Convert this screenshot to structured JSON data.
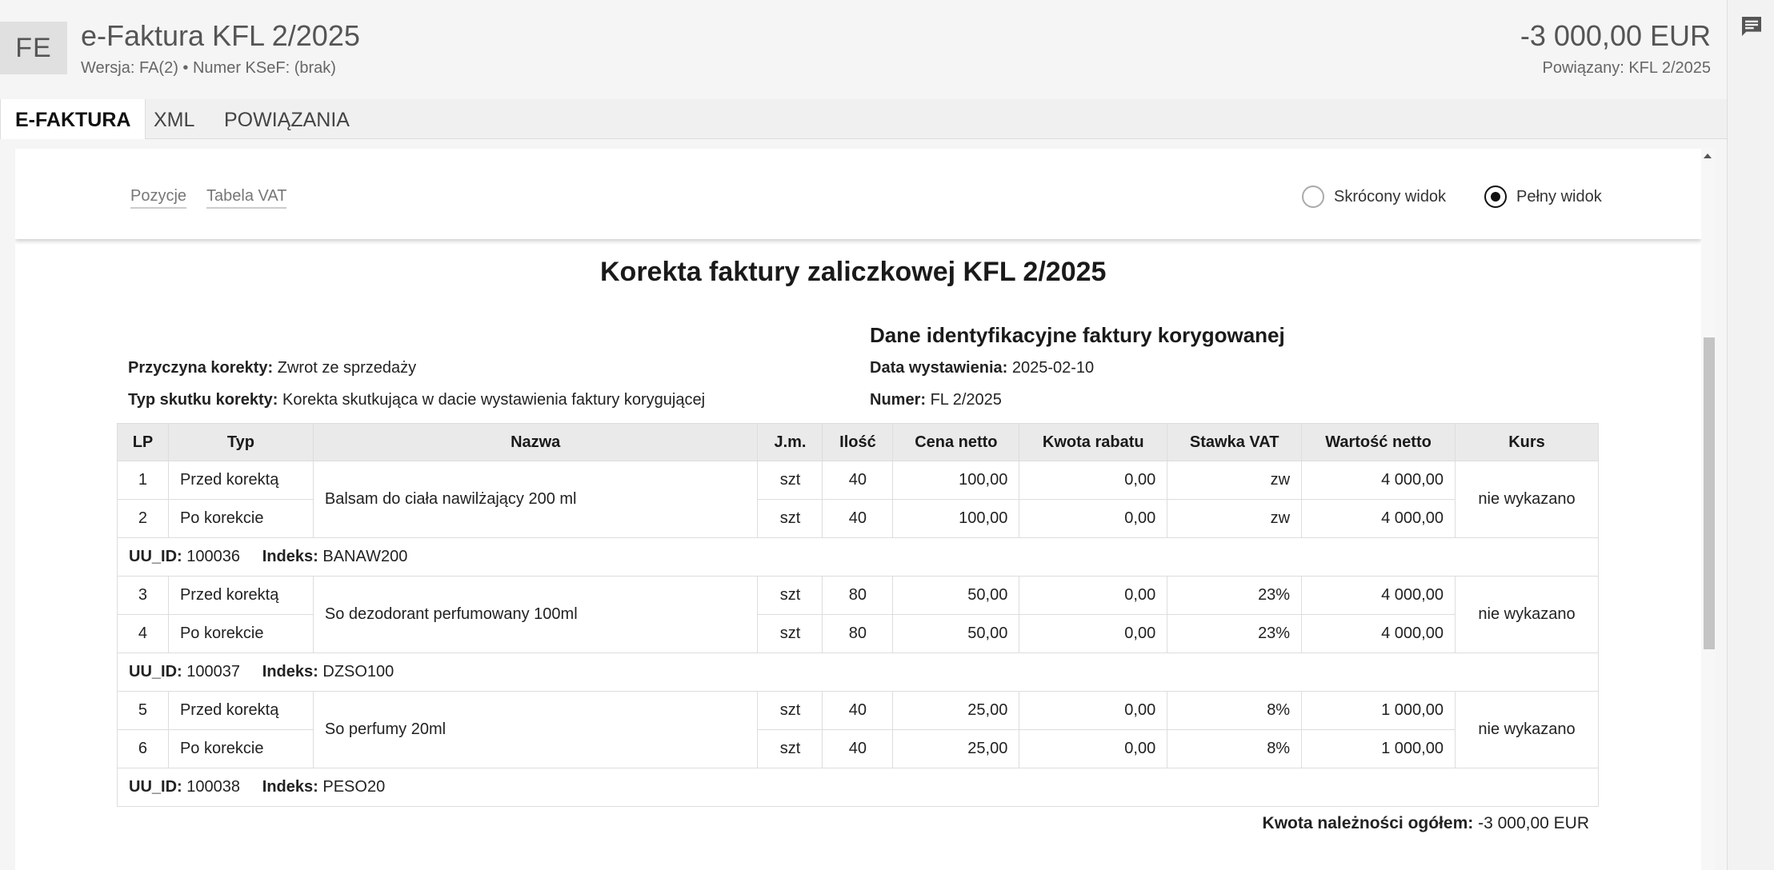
{
  "header": {
    "avatar": "FE",
    "title": "e-Faktura KFL 2/2025",
    "subtitle": "Wersja: FA(2) • Numer KSeF: (brak)",
    "amount": "-3 000,00 EUR",
    "linked": "Powiązany: KFL 2/2025"
  },
  "tabs": [
    {
      "label": "E-FAKTURA",
      "active": true
    },
    {
      "label": "XML",
      "active": false
    },
    {
      "label": "POWIĄZANIA",
      "active": false
    }
  ],
  "toolbar": {
    "link_positions": "Pozycje",
    "link_vat": "Tabela VAT",
    "radio_short": "Skrócony widok",
    "radio_full": "Pełny widok",
    "selected": "Pełny widok"
  },
  "invoice": {
    "title": "Korekta faktury zaliczkowej KFL 2/2025",
    "reason_label": "Przyczyna korekty:",
    "reason_value": "Zwrot ze sprzedaży",
    "effect_label": "Typ skutku korekty:",
    "effect_value": "Korekta skutkująca w dacie wystawienia faktury korygującej",
    "corrected_heading": "Dane identyfikacyjne faktury korygowanej",
    "issue_date_label": "Data wystawienia:",
    "issue_date_value": "2025-02-10",
    "number_label": "Numer:",
    "number_value": "FL 2/2025",
    "columns": [
      "LP",
      "Typ",
      "Nazwa",
      "J.m.",
      "Ilość",
      "Cena netto",
      "Kwota rabatu",
      "Stawka VAT",
      "Wartość netto",
      "Kurs"
    ],
    "groups": [
      {
        "name": "Balsam do ciała nawilżający 200 ml",
        "kurs": "nie wykazano",
        "rows": [
          {
            "lp": "1",
            "typ": "Przed korektą",
            "jm": "szt",
            "ilosc": "40",
            "cena": "100,00",
            "rabat": "0,00",
            "vat": "zw",
            "wartosc": "4 000,00"
          },
          {
            "lp": "2",
            "typ": "Po korekcie",
            "jm": "szt",
            "ilosc": "40",
            "cena": "100,00",
            "rabat": "0,00",
            "vat": "zw",
            "wartosc": "4 000,00"
          }
        ],
        "uu_label": "UU_ID:",
        "uu_value": "100036",
        "idx_label": "Indeks:",
        "idx_value": "BANAW200"
      },
      {
        "name": "So dezodorant perfumowany 100ml",
        "kurs": "nie wykazano",
        "rows": [
          {
            "lp": "3",
            "typ": "Przed korektą",
            "jm": "szt",
            "ilosc": "80",
            "cena": "50,00",
            "rabat": "0,00",
            "vat": "23%",
            "wartosc": "4 000,00"
          },
          {
            "lp": "4",
            "typ": "Po korekcie",
            "jm": "szt",
            "ilosc": "80",
            "cena": "50,00",
            "rabat": "0,00",
            "vat": "23%",
            "wartosc": "4 000,00"
          }
        ],
        "uu_label": "UU_ID:",
        "uu_value": "100037",
        "idx_label": "Indeks:",
        "idx_value": "DZSO100"
      },
      {
        "name": "So perfumy 20ml",
        "kurs": "nie wykazano",
        "rows": [
          {
            "lp": "5",
            "typ": "Przed korektą",
            "jm": "szt",
            "ilosc": "40",
            "cena": "25,00",
            "rabat": "0,00",
            "vat": "8%",
            "wartosc": "1 000,00"
          },
          {
            "lp": "6",
            "typ": "Po korekcie",
            "jm": "szt",
            "ilosc": "40",
            "cena": "25,00",
            "rabat": "0,00",
            "vat": "8%",
            "wartosc": "1 000,00"
          }
        ],
        "uu_label": "UU_ID:",
        "uu_value": "100038",
        "idx_label": "Indeks:",
        "idx_value": "PESO20"
      }
    ],
    "total_label": "Kwota należności ogółem:",
    "total_value": "-3 000,00 EUR"
  },
  "icons": {
    "chat": "chat-icon"
  }
}
